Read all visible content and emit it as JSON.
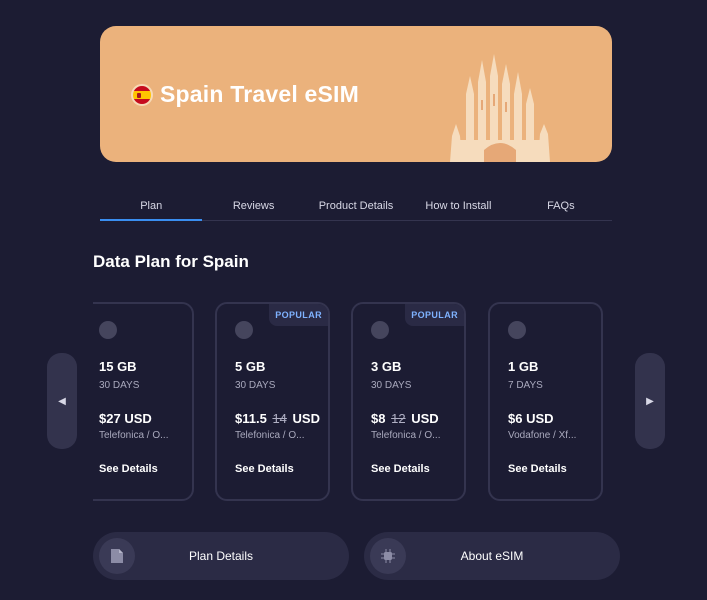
{
  "hero": {
    "title": "Spain Travel eSIM",
    "color": "#ebb27c"
  },
  "tabs": [
    "Plan",
    "Reviews",
    "Product Details",
    "How to Install",
    "FAQs"
  ],
  "section_title": "Data Plan for Spain",
  "plans": [
    {
      "data": "15 GB",
      "days": "30 DAYS",
      "price": "$27",
      "old_price": "",
      "currency": "USD",
      "carrier": "Telefonica / O...",
      "details": "See Details",
      "badge": ""
    },
    {
      "data": "5 GB",
      "days": "30 DAYS",
      "price": "$11.5",
      "old_price": "14",
      "currency": "USD",
      "carrier": "Telefonica / O...",
      "details": "See Details",
      "badge": "POPULAR"
    },
    {
      "data": "3 GB",
      "days": "30 DAYS",
      "price": "$8",
      "old_price": "12",
      "currency": "USD",
      "carrier": "Telefonica / O...",
      "details": "See Details",
      "badge": "POPULAR"
    },
    {
      "data": "1 GB",
      "days": "7 DAYS",
      "price": "$6",
      "old_price": "",
      "currency": "USD",
      "carrier": "Vodafone / Xf...",
      "details": "See Details",
      "badge": ""
    }
  ],
  "nav": {
    "prev_icon": "◀",
    "next_icon": "▶"
  },
  "buttons": {
    "plan_details": "Plan Details",
    "about_esim": "About eSIM"
  },
  "icons": {
    "plan_details": "document-icon",
    "about_esim": "chip-icon"
  },
  "colors": {
    "background": "#1c1c33",
    "accent": "#3a8ef0",
    "badge_text": "#7fb2ff"
  }
}
